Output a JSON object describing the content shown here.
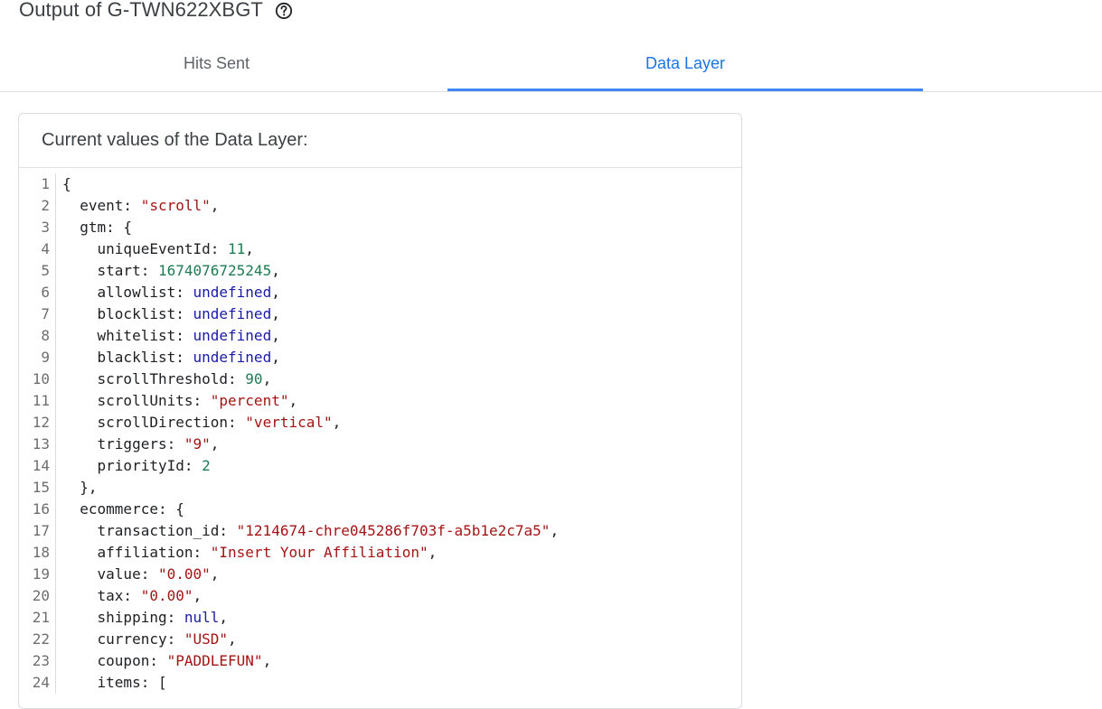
{
  "header": {
    "title": "Output of G-TWN622XBGT",
    "help_icon": "help-circle-icon"
  },
  "tabs": [
    {
      "label": "Hits Sent",
      "active": false
    },
    {
      "label": "Data Layer",
      "active": true
    }
  ],
  "colors": {
    "accent": "#1a73e8",
    "tab_indicator": "#4285f4",
    "string": "#a31515",
    "number": "#1e7a52",
    "keyword": "#1a1aa6"
  },
  "card": {
    "title": "Current values of the Data Layer:"
  },
  "code_lines": [
    {
      "n": "1",
      "indent": 0,
      "tokens": [
        [
          "p",
          "{"
        ]
      ]
    },
    {
      "n": "2",
      "indent": 1,
      "tokens": [
        [
          "p",
          "event: "
        ],
        [
          "s",
          "\"scroll\""
        ],
        [
          "p",
          ","
        ]
      ]
    },
    {
      "n": "3",
      "indent": 1,
      "tokens": [
        [
          "p",
          "gtm: {"
        ]
      ]
    },
    {
      "n": "4",
      "indent": 2,
      "tokens": [
        [
          "p",
          "uniqueEventId: "
        ],
        [
          "n",
          "11"
        ],
        [
          "p",
          ","
        ]
      ]
    },
    {
      "n": "5",
      "indent": 2,
      "tokens": [
        [
          "p",
          "start: "
        ],
        [
          "n",
          "1674076725245"
        ],
        [
          "p",
          ","
        ]
      ]
    },
    {
      "n": "6",
      "indent": 2,
      "tokens": [
        [
          "p",
          "allowlist: "
        ],
        [
          "k",
          "undefined"
        ],
        [
          "p",
          ","
        ]
      ]
    },
    {
      "n": "7",
      "indent": 2,
      "tokens": [
        [
          "p",
          "blocklist: "
        ],
        [
          "k",
          "undefined"
        ],
        [
          "p",
          ","
        ]
      ]
    },
    {
      "n": "8",
      "indent": 2,
      "tokens": [
        [
          "p",
          "whitelist: "
        ],
        [
          "k",
          "undefined"
        ],
        [
          "p",
          ","
        ]
      ]
    },
    {
      "n": "9",
      "indent": 2,
      "tokens": [
        [
          "p",
          "blacklist: "
        ],
        [
          "k",
          "undefined"
        ],
        [
          "p",
          ","
        ]
      ]
    },
    {
      "n": "10",
      "indent": 2,
      "tokens": [
        [
          "p",
          "scrollThreshold: "
        ],
        [
          "n",
          "90"
        ],
        [
          "p",
          ","
        ]
      ]
    },
    {
      "n": "11",
      "indent": 2,
      "tokens": [
        [
          "p",
          "scrollUnits: "
        ],
        [
          "s",
          "\"percent\""
        ],
        [
          "p",
          ","
        ]
      ]
    },
    {
      "n": "12",
      "indent": 2,
      "tokens": [
        [
          "p",
          "scrollDirection: "
        ],
        [
          "s",
          "\"vertical\""
        ],
        [
          "p",
          ","
        ]
      ]
    },
    {
      "n": "13",
      "indent": 2,
      "tokens": [
        [
          "p",
          "triggers: "
        ],
        [
          "s",
          "\"9\""
        ],
        [
          "p",
          ","
        ]
      ]
    },
    {
      "n": "14",
      "indent": 2,
      "tokens": [
        [
          "p",
          "priorityId: "
        ],
        [
          "n",
          "2"
        ]
      ]
    },
    {
      "n": "15",
      "indent": 1,
      "tokens": [
        [
          "p",
          "},"
        ]
      ]
    },
    {
      "n": "16",
      "indent": 1,
      "tokens": [
        [
          "p",
          "ecommerce: {"
        ]
      ]
    },
    {
      "n": "17",
      "indent": 2,
      "tokens": [
        [
          "p",
          "transaction_id: "
        ],
        [
          "s",
          "\"1214674-chre045286f703f-a5b1e2c7a5\""
        ],
        [
          "p",
          ","
        ]
      ]
    },
    {
      "n": "18",
      "indent": 2,
      "tokens": [
        [
          "p",
          "affiliation: "
        ],
        [
          "s",
          "\"Insert Your Affiliation\""
        ],
        [
          "p",
          ","
        ]
      ]
    },
    {
      "n": "19",
      "indent": 2,
      "tokens": [
        [
          "p",
          "value: "
        ],
        [
          "s",
          "\"0.00\""
        ],
        [
          "p",
          ","
        ]
      ]
    },
    {
      "n": "20",
      "indent": 2,
      "tokens": [
        [
          "p",
          "tax: "
        ],
        [
          "s",
          "\"0.00\""
        ],
        [
          "p",
          ","
        ]
      ]
    },
    {
      "n": "21",
      "indent": 2,
      "tokens": [
        [
          "p",
          "shipping: "
        ],
        [
          "k",
          "null"
        ],
        [
          "p",
          ","
        ]
      ]
    },
    {
      "n": "22",
      "indent": 2,
      "tokens": [
        [
          "p",
          "currency: "
        ],
        [
          "s",
          "\"USD\""
        ],
        [
          "p",
          ","
        ]
      ]
    },
    {
      "n": "23",
      "indent": 2,
      "tokens": [
        [
          "p",
          "coupon: "
        ],
        [
          "s",
          "\"PADDLEFUN\""
        ],
        [
          "p",
          ","
        ]
      ]
    },
    {
      "n": "24",
      "indent": 2,
      "tokens": [
        [
          "p",
          "items: ["
        ]
      ]
    }
  ]
}
